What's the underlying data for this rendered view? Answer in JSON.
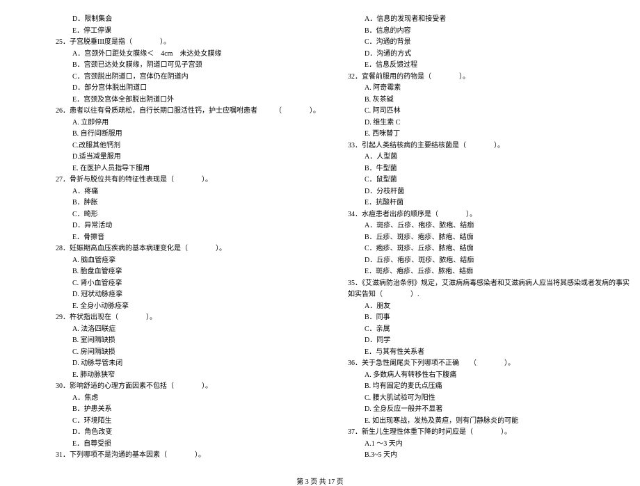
{
  "left": [
    {
      "cls": "opt",
      "t": "D．限制集会"
    },
    {
      "cls": "opt",
      "t": "E．停工停课"
    },
    {
      "cls": "qnum",
      "t": "25．子宫脱垂III度是指（　　　　）。"
    },
    {
      "cls": "opt",
      "t": "A．宫颈外口距处女膜缘＜　4cm　未达处女膜缘"
    },
    {
      "cls": "opt",
      "t": "B．宫颈已达处女膜缘，阴道口可见子宫颈"
    },
    {
      "cls": "opt",
      "t": "C．宫颈脱出阴道口，宫体仍在阴道内"
    },
    {
      "cls": "opt",
      "t": "D．部分宫体脱出阴道口"
    },
    {
      "cls": "opt",
      "t": "E．宫颈及宫体全部脱出阴道口外"
    },
    {
      "cls": "qnum",
      "t": "26．患者以往有骨质疏松，自行长期口服活性钙，护士应嘱咐患者　　　（　　　　）。"
    },
    {
      "cls": "opt",
      "t": "A. 立即停用"
    },
    {
      "cls": "opt",
      "t": "B. 自行间断服用"
    },
    {
      "cls": "opt",
      "t": "C.改服其他钙剂"
    },
    {
      "cls": "opt",
      "t": "D.适当减量服用"
    },
    {
      "cls": "opt",
      "t": "E. 在医护人员指导下服用"
    },
    {
      "cls": "qnum",
      "t": "27．骨折与脱位共有的特征性表现是（　　　　）。"
    },
    {
      "cls": "opt",
      "t": "A．疼痛"
    },
    {
      "cls": "opt",
      "t": "B．肿胀"
    },
    {
      "cls": "opt",
      "t": "C．畸形"
    },
    {
      "cls": "opt",
      "t": "D．异常活动"
    },
    {
      "cls": "opt",
      "t": "E．骨擦音"
    },
    {
      "cls": "qnum",
      "t": "28．妊娠期高血压疾病的基本病理变化是（　　　　）。"
    },
    {
      "cls": "opt",
      "t": "A. 脑血管痉挛"
    },
    {
      "cls": "opt",
      "t": "B. 胎盘血管痉挛"
    },
    {
      "cls": "opt",
      "t": "C. 肾小血管痉挛"
    },
    {
      "cls": "opt",
      "t": "D. 冠状动脉痉挛"
    },
    {
      "cls": "opt",
      "t": "E. 全身小动脉痉挛"
    },
    {
      "cls": "qnum",
      "t": "29．杵状指出现在（　　　　）。"
    },
    {
      "cls": "opt",
      "t": "A. 法洛四联症"
    },
    {
      "cls": "opt",
      "t": "B. 室间隔缺损"
    },
    {
      "cls": "opt",
      "t": "C. 房间隔缺损"
    },
    {
      "cls": "opt",
      "t": "D. 动脉导管未闭"
    },
    {
      "cls": "opt",
      "t": "E. 肺动脉狭窄"
    },
    {
      "cls": "qnum",
      "t": "30．影响舒适的心理方面因素不包括（　　　　）。"
    },
    {
      "cls": "opt",
      "t": "A．焦虑"
    },
    {
      "cls": "opt",
      "t": "B．护患关系"
    },
    {
      "cls": "opt",
      "t": "C．环境陌生"
    },
    {
      "cls": "opt",
      "t": "D．角色改变"
    },
    {
      "cls": "opt",
      "t": "E．自尊受损"
    },
    {
      "cls": "qnum",
      "t": "31．下列哪项不是沟通的基本因素（　　　　）。"
    }
  ],
  "right": [
    {
      "cls": "opt",
      "t": "A．信息的发现者和接受者"
    },
    {
      "cls": "opt",
      "t": "B．信息的内容"
    },
    {
      "cls": "opt",
      "t": "C．沟通的背景"
    },
    {
      "cls": "opt",
      "t": "D．沟通的方式"
    },
    {
      "cls": "opt",
      "t": "E．信息反馈过程"
    },
    {
      "cls": "qnum",
      "t": "32．宜餐前服用的药物是（　　　　）。"
    },
    {
      "cls": "opt",
      "t": "A. 阿奇霉素"
    },
    {
      "cls": "opt",
      "t": "B. 灰茶碱"
    },
    {
      "cls": "opt",
      "t": "C. 阿司匹林"
    },
    {
      "cls": "opt",
      "t": "D. 维生素 C"
    },
    {
      "cls": "opt",
      "t": "E. 西咪替丁"
    },
    {
      "cls": "qnum",
      "t": "33．引起人类结核病的主要结核菌是（　　　　）。"
    },
    {
      "cls": "opt",
      "t": "A．人型菌"
    },
    {
      "cls": "opt",
      "t": "B．牛型菌"
    },
    {
      "cls": "opt",
      "t": "C．鼠型菌"
    },
    {
      "cls": "opt",
      "t": "D．分枝杆菌"
    },
    {
      "cls": "opt",
      "t": "E．抗酸杆菌"
    },
    {
      "cls": "qnum",
      "t": "34．水痘患者出疹的顺序是（　　　　）。"
    },
    {
      "cls": "opt",
      "t": "A．斑疹、丘疹、疱疹、脓疱、结痂"
    },
    {
      "cls": "opt",
      "t": "B．丘疹、斑疹、疱疹、脓疱、结痂"
    },
    {
      "cls": "opt",
      "t": "C．疱疹、斑疹、丘疹、脓疱、结痂"
    },
    {
      "cls": "opt",
      "t": "D．丘疹、疱疹、斑疹、脓疱、结痂"
    },
    {
      "cls": "opt",
      "t": "E．斑疹、疱疹、丘疹、脓疱、结痂"
    },
    {
      "cls": "qnum",
      "t": "35．《艾滋病防治条例》规定，艾滋病病毒感染者和艾滋病病人应当将其感染或者发病的事实"
    },
    {
      "cls": "qnum",
      "t": "如实告知（　　　　）."
    },
    {
      "cls": "opt",
      "t": "A．朋友"
    },
    {
      "cls": "opt",
      "t": "B．同事"
    },
    {
      "cls": "opt",
      "t": "C．亲属"
    },
    {
      "cls": "opt",
      "t": "D．同学"
    },
    {
      "cls": "opt",
      "t": "E．与其有性关系者"
    },
    {
      "cls": "qnum",
      "t": "36．关于急性阑尾炎下列哪项不正确　　（　　　　）。"
    },
    {
      "cls": "opt",
      "t": "A. 多数病人有转移性右下腹痛"
    },
    {
      "cls": "opt",
      "t": "B. 均有固定的麦氏点压痛"
    },
    {
      "cls": "opt",
      "t": "C. 腰大肌试验可为阳性"
    },
    {
      "cls": "opt",
      "t": "D. 全身反应一般并不显著"
    },
    {
      "cls": "opt",
      "t": "E. 如出现寒战，发热及黄疸，则有门静脉炎的可能"
    },
    {
      "cls": "qnum",
      "t": "37．新生儿生理性体重下降的时间应是（　　　　）。"
    },
    {
      "cls": "opt",
      "t": "A.1 ～3 天内"
    },
    {
      "cls": "opt",
      "t": "B.3~5 天内"
    }
  ],
  "footer": "第 3 页 共 17 页"
}
